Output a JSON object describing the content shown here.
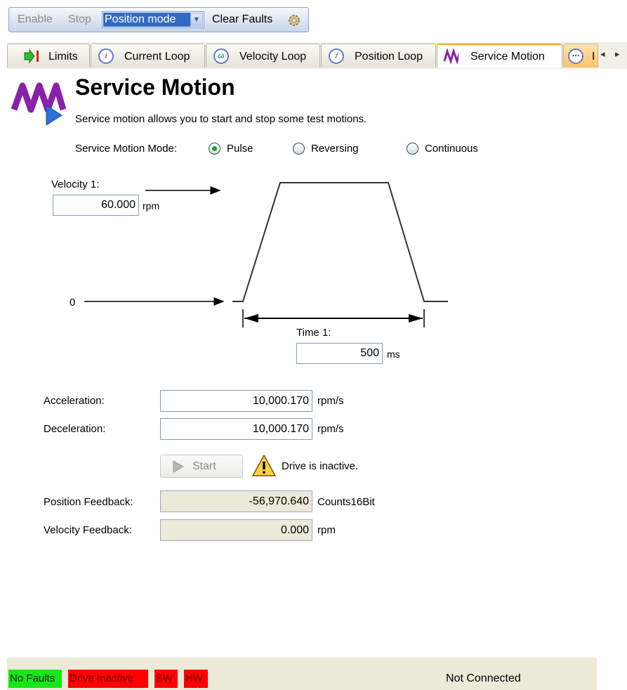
{
  "toolbar": {
    "enable_label": "Enable",
    "stop_label": "Stop",
    "mode_selected": "Position mode",
    "clear_faults_label": "Clear Faults"
  },
  "tabs": [
    {
      "label": "Limits",
      "icon": "limits-arrow-icon"
    },
    {
      "label": "Current Loop",
      "icon": "current-loop-icon"
    },
    {
      "label": "Velocity Loop",
      "icon": "velocity-loop-icon"
    },
    {
      "label": "Position Loop",
      "icon": "position-loop-icon"
    },
    {
      "label": "Service Motion",
      "icon": "service-motion-icon",
      "active": true
    },
    {
      "label": "I",
      "icon": "next-tab-icon"
    }
  ],
  "header": {
    "title": "Service Motion",
    "subtitle": "Service motion allows you to start and stop some test motions."
  },
  "mode": {
    "label": "Service Motion Mode:",
    "options": [
      "Pulse",
      "Reversing",
      "Continuous"
    ],
    "selected": "Pulse"
  },
  "diagram": {
    "velocity_label": "Velocity 1:",
    "velocity_value": "60.000",
    "velocity_unit": "rpm",
    "zero_label": "0",
    "time_label": "Time 1:",
    "time_value": "500",
    "time_unit": "ms"
  },
  "params": {
    "acceleration_label": "Acceleration:",
    "acceleration_value": "10,000.170",
    "acceleration_unit": "rpm/s",
    "deceleration_label": "Deceleration:",
    "deceleration_value": "10,000.170",
    "deceleration_unit": "rpm/s"
  },
  "start": {
    "label": "Start",
    "warning": "Drive is inactive."
  },
  "feedback": {
    "position_label": "Position Feedback:",
    "position_value": "-56,970.640",
    "position_unit": "Counts16Bit",
    "velocity_label": "Velocity Feedback:",
    "velocity_value": "0.000",
    "velocity_unit": "rpm"
  },
  "status": {
    "no_faults": "No Faults",
    "drive_inactive": "Drive Inactive",
    "sw": "SW",
    "hw": "HW",
    "connection": "Not Connected"
  },
  "colors": {
    "ok": "#19e619",
    "fault": "#ff0000",
    "accent": "#8a1fa8",
    "selection": "#316ac5"
  }
}
